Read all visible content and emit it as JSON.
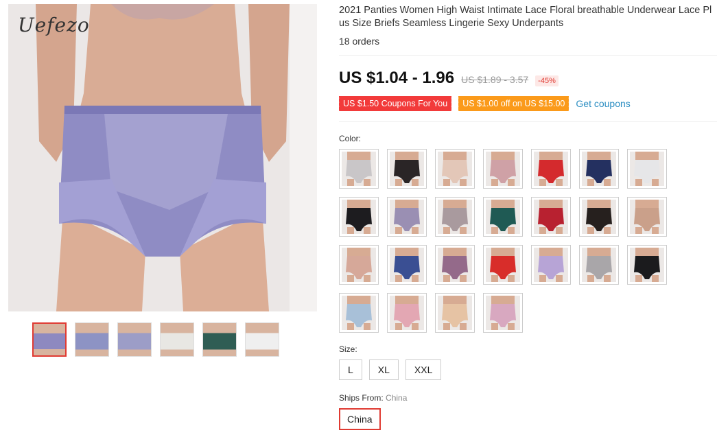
{
  "product": {
    "brand_watermark": "Uefezo",
    "title": "2021 Panties Women High Waist Intimate Lace Floral breathable Underwear Lace Pl us Size Briefs Seamless Lingerie Sexy Underpants",
    "orders": "18 orders",
    "price": "US $1.04 - 1.96",
    "original_price": "US $1.89 - 3.57",
    "discount": "-45%"
  },
  "coupons": {
    "coupon1": "US $1.50 Coupons For You",
    "coupon2": "US $1.00 off on US $15.00",
    "get_coupons": "Get coupons",
    "colors": {
      "coupon1": "#f23a3a",
      "coupon2": "#fb9a1a",
      "link": "#2c8ec2"
    }
  },
  "gallery": {
    "thumbnails": [
      {
        "name": "lavender lace front",
        "color": "#8e89c0"
      },
      {
        "name": "lavender lace on model",
        "color": "#8d93c4"
      },
      {
        "name": "lavender back view",
        "color": "#9c9dc7"
      },
      {
        "name": "white lace lying",
        "color": "#e8e7e3"
      },
      {
        "name": "green lace lying",
        "color": "#2f5d54"
      },
      {
        "name": "white flat",
        "color": "#efefef"
      }
    ]
  },
  "color_option": {
    "label": "Color:",
    "swatches": [
      "#c9c6c8",
      "#2a2526",
      "#e3c7b8",
      "#cfa1a6",
      "#d42a2d",
      "#243060",
      "#e6e6e8",
      "#1d1c1f",
      "#9a8fb3",
      "#a99a9e",
      "#1f5a54",
      "#b82130",
      "#26201e",
      "#caa08a",
      "#d6a899",
      "#3a4f93",
      "#946a8a",
      "#d82d2a",
      "#b7a4d6",
      "#a9a6a9",
      "#1b1b1d",
      "#a8c0d8",
      "#e3a7b3",
      "#e6c3a4",
      "#d8a8c0"
    ]
  },
  "size_option": {
    "label": "Size:",
    "options": [
      "L",
      "XL",
      "XXL"
    ]
  },
  "shipping": {
    "label": "Ships From:",
    "value": "China",
    "selected": "China"
  },
  "accent_color": "#e03a32"
}
